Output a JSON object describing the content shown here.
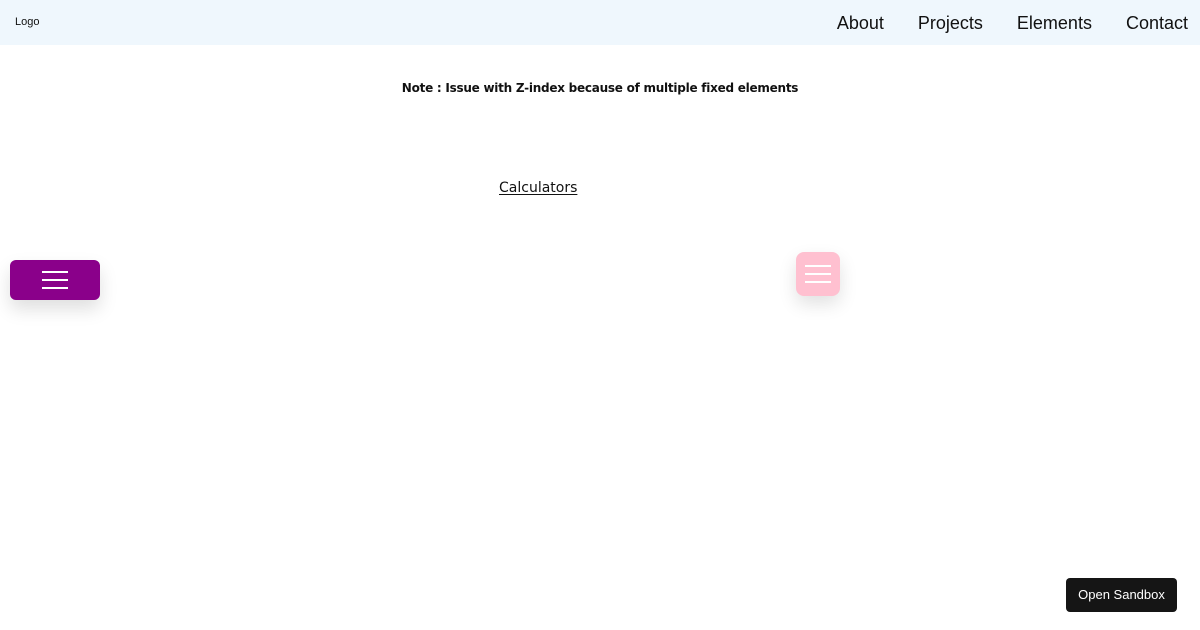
{
  "header": {
    "logo": "Logo",
    "nav": [
      {
        "label": "About"
      },
      {
        "label": "Projects"
      },
      {
        "label": "Elements"
      },
      {
        "label": "Contact"
      }
    ]
  },
  "content": {
    "note": "Note : Issue with Z-index because of multiple fixed elements",
    "calculators_link": "Calculators"
  },
  "controls": {
    "purple_menu_icon": "hamburger-icon",
    "pink_menu_icon": "hamburger-icon",
    "sandbox_button": "Open Sandbox"
  },
  "colors": {
    "header_background": "#eff7fd",
    "purple_menu": "#8a008a",
    "pink_menu": "#ffc0d0",
    "sandbox_button": "#151515",
    "menu_lines": "#ffffff"
  }
}
